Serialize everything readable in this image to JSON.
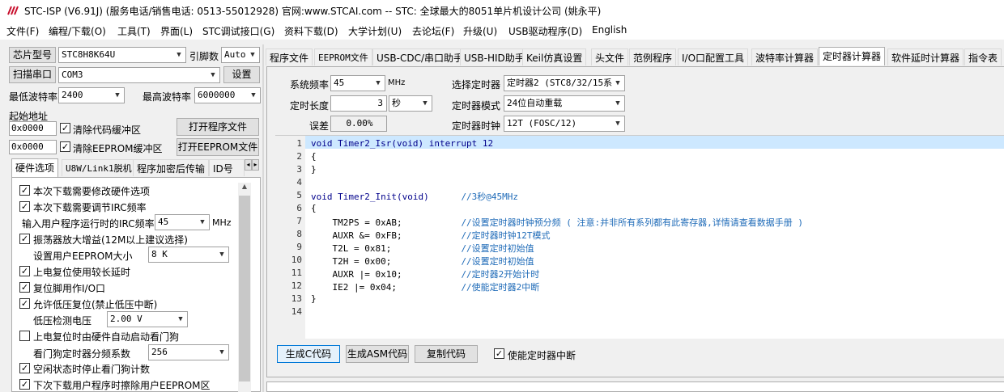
{
  "window": {
    "title": "STC-ISP (V6.91J) (服务电话/销售电话: 0513-55012928) 官网:www.STCAI.com  -- STC: 全球最大的8051单片机设计公司 (姚永平)"
  },
  "menu": [
    "文件(F)",
    "编程/下载(O)",
    "工具(T)",
    "界面(L)",
    "STC调试接口(G)",
    "资料下载(D)",
    "大学计划(U)",
    "去论坛(F)",
    "升级(U)",
    "USB驱动程序(D)",
    "English"
  ],
  "left": {
    "chip_label": "芯片型号",
    "chip_value": "STC8H8K64U",
    "pins_label": "引脚数",
    "pins_value": "Auto",
    "scan_button": "扫描串口",
    "port_value": "COM3",
    "settings_button": "设置",
    "min_baud_label": "最低波特率",
    "min_baud_value": "2400",
    "max_baud_label": "最高波特率",
    "max_baud_value": "6000000",
    "start_addr_label": "起始地址",
    "addr1": "0x0000",
    "clear_code_label": "清除代码缓冲区",
    "open_prog_button": "打开程序文件",
    "addr2": "0x0000",
    "clear_eeprom_label": "清除EEPROM缓冲区",
    "open_eeprom_button": "打开EEPROM文件",
    "tabs": [
      "硬件选项",
      "U8W/Link1脱机",
      "程序加密后传输",
      "ID号"
    ],
    "options": {
      "opt1": "本次下载需要修改硬件选项",
      "opt2": "本次下载需要调节IRC频率",
      "irc_label": "输入用户程序运行时的IRC频率",
      "irc_value": "45",
      "irc_unit": "MHz",
      "opt3": "振荡器放大增益(12M以上建议选择)",
      "eeprom_size_label": "设置用户EEPROM大小",
      "eeprom_size_value": "8    K",
      "opt4": "上电复位使用较长延时",
      "opt5": "复位脚用作I/O口",
      "opt6": "允许低压复位(禁止低压中断)",
      "lvd_label": "低压检测电压",
      "lvd_value": "2.00 V",
      "opt7": "上电复位时由硬件自动启动看门狗",
      "wdt_label": "看门狗定时器分频系数",
      "wdt_value": "256",
      "opt8": "空闲状态时停止看门狗计数",
      "opt9": "下次下载用户程序时擦除用户EEPROM区"
    }
  },
  "right": {
    "tabs": [
      "程序文件",
      "EEPROM文件",
      "USB-CDC/串口助手",
      "USB-HID助手",
      "Keil仿真设置",
      "头文件",
      "范例程序",
      "I/O口配置工具",
      "波特率计算器",
      "定时器计算器",
      "软件延时计算器",
      "指令表"
    ],
    "active_tab": "定时器计算器",
    "sysfreq_label": "系统频率",
    "sysfreq_value": "45",
    "sysfreq_unit": "MHz",
    "timer_sel_label": "选择定时器",
    "timer_sel_value": "定时器2 (STC8/32/15系",
    "timelen_label": "定时长度",
    "timelen_value": "3",
    "timelen_unit": "秒",
    "mode_label": "定时器模式",
    "mode_value": "24位自动重载",
    "error_label": "误差",
    "error_value": "0.00%",
    "clock_label": "定时器时钟",
    "clock_value": "12T (FOSC/12)",
    "code_lines": [
      {
        "n": "1",
        "t": "void Timer2_Isr(void) interrupt 12",
        "c": ""
      },
      {
        "n": "2",
        "t": "{",
        "c": ""
      },
      {
        "n": "3",
        "t": "}",
        "c": ""
      },
      {
        "n": "4",
        "t": "",
        "c": ""
      },
      {
        "n": "5",
        "t": "void Timer2_Init(void)      ",
        "c": "//3秒@45MHz"
      },
      {
        "n": "6",
        "t": "{",
        "c": ""
      },
      {
        "n": "7",
        "t": "    TM2PS = 0xAB;           ",
        "c": "//设置定时器时钟预分频 ( 注意:并非所有系列都有此寄存器,详情请查看数据手册 )"
      },
      {
        "n": "8",
        "t": "    AUXR &= 0xFB;           ",
        "c": "//定时器时钟12T模式"
      },
      {
        "n": "9",
        "t": "    T2L = 0x81;             ",
        "c": "//设置定时初始值"
      },
      {
        "n": "10",
        "t": "    T2H = 0x00;             ",
        "c": "//设置定时初始值"
      },
      {
        "n": "11",
        "t": "    AUXR |= 0x10;           ",
        "c": "//定时器2开始计时"
      },
      {
        "n": "12",
        "t": "    IE2 |= 0x04;            ",
        "c": "//使能定时器2中断"
      },
      {
        "n": "13",
        "t": "}",
        "c": ""
      },
      {
        "n": "14",
        "t": "",
        "c": ""
      }
    ],
    "gen_c_button": "生成C代码",
    "gen_asm_button": "生成ASM代码",
    "copy_button": "复制代码",
    "enable_int_label": "使能定时器中断"
  }
}
